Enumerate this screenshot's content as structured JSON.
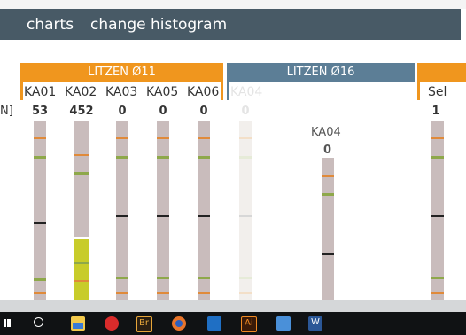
{
  "header": {
    "title": "charts",
    "action": "change histogram"
  },
  "groups": [
    {
      "label": "LITZEN Ø11",
      "color": "#f0961e"
    },
    {
      "label": "LITZEN Ø16",
      "color": "#5c7e96"
    },
    {
      "label": "",
      "color": "#f0961e"
    }
  ],
  "axis_unit_fragment": "N]",
  "columns": [
    {
      "label": "KA01",
      "count": "53"
    },
    {
      "label": "KA02",
      "count": "452"
    },
    {
      "label": "KA03",
      "count": "0"
    },
    {
      "label": "KA05",
      "count": "0"
    },
    {
      "label": "KA06",
      "count": "0"
    },
    {
      "label": "KA04",
      "count": "0"
    },
    {
      "label": "Sel",
      "count": "1"
    }
  ],
  "floating": {
    "label": "KA04",
    "count": "0"
  },
  "colors": {
    "bar": "#c9bcbc",
    "orange": "#e08a3a",
    "green": "#8ea84a",
    "black": "#222222",
    "highlight": "#c8cc2a"
  },
  "taskbar": {
    "icons": [
      "windows-icon",
      "search-icon",
      "file-explorer-icon",
      "opera-icon",
      "bridge-icon",
      "firefox-icon",
      "outlook-icon",
      "illustrator-icon",
      "photos-icon",
      "word-icon"
    ],
    "bridge_text": "Br",
    "illustrator_text": "Ai",
    "word_text": "W"
  }
}
